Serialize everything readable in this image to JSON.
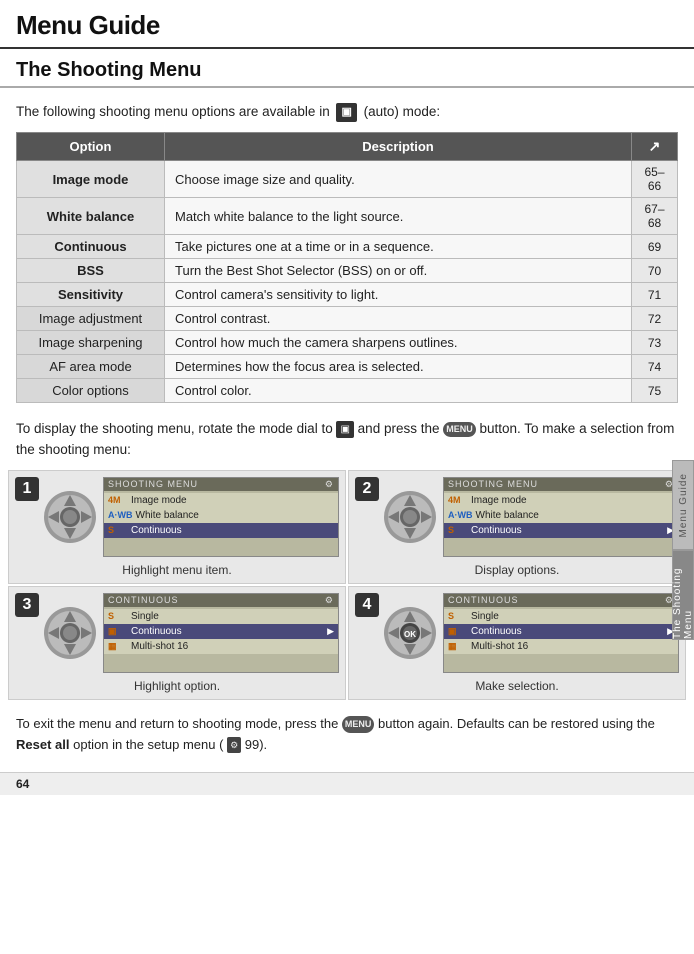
{
  "header": {
    "title": "Menu Guide"
  },
  "section": {
    "title": "The Shooting Menu"
  },
  "intro": {
    "text": "The following shooting menu options are available in",
    "mode": "(auto) mode:"
  },
  "table": {
    "col_option": "Option",
    "col_desc": "Description",
    "col_page_icon": "↗",
    "rows": [
      {
        "option": "Image mode",
        "desc": "Choose image size and quality.",
        "page": "65–66",
        "bold": true
      },
      {
        "option": "White balance",
        "desc": "Match white balance to the light source.",
        "page": "67–68",
        "bold": true
      },
      {
        "option": "Continuous",
        "desc": "Take pictures one at a time or in a sequence.",
        "page": "69",
        "bold": true
      },
      {
        "option": "BSS",
        "desc": "Turn the Best Shot Selector (BSS) on or off.",
        "page": "70",
        "bold": true
      },
      {
        "option": "Sensitivity",
        "desc": "Control camera's sensitivity to light.",
        "page": "71",
        "bold": true
      },
      {
        "option": "Image adjustment",
        "desc": "Control contrast.",
        "page": "72",
        "bold": false
      },
      {
        "option": "Image sharpening",
        "desc": "Control how much the camera sharpens outlines.",
        "page": "73",
        "bold": false
      },
      {
        "option": "AF area mode",
        "desc": "Determines how the focus area is selected.",
        "page": "74",
        "bold": false
      },
      {
        "option": "Color options",
        "desc": "Control color.",
        "page": "75",
        "bold": false
      }
    ]
  },
  "desc_para": {
    "text1": "To display the shooting menu, rotate the mode dial to",
    "text2": "and press the",
    "text3": "button.  To make a selection from the shooting menu:"
  },
  "steps": [
    {
      "number": "1",
      "caption": "Highlight menu item.",
      "screen_title": "SHOOTING MENU",
      "rows": [
        {
          "icon": "4M",
          "icon_color": "orange",
          "label": "Image mode",
          "highlighted": false,
          "arrow": false
        },
        {
          "icon": "A·WB",
          "icon_color": "blue",
          "label": "White balance",
          "highlighted": false,
          "arrow": false
        },
        {
          "icon": "S",
          "icon_color": "orange",
          "label": "Continuous",
          "highlighted": true,
          "arrow": false
        }
      ]
    },
    {
      "number": "2",
      "caption": "Display options.",
      "screen_title": "SHOOTING MENU",
      "rows": [
        {
          "icon": "4M",
          "icon_color": "orange",
          "label": "Image mode",
          "highlighted": false,
          "arrow": false
        },
        {
          "icon": "A·WB",
          "icon_color": "blue",
          "label": "White balance",
          "highlighted": false,
          "arrow": false
        },
        {
          "icon": "S",
          "icon_color": "orange",
          "label": "Continuous",
          "highlighted": true,
          "arrow": true
        }
      ]
    },
    {
      "number": "3",
      "caption": "Highlight option.",
      "screen_title": "CONTINUOUS",
      "rows": [
        {
          "icon": "S",
          "icon_color": "orange",
          "label": "Single",
          "highlighted": false,
          "arrow": false
        },
        {
          "icon": "▣",
          "icon_color": "orange",
          "label": "Continuous",
          "highlighted": true,
          "arrow": true
        },
        {
          "icon": "▦",
          "icon_color": "orange",
          "label": "Multi-shot 16",
          "highlighted": false,
          "arrow": false
        }
      ]
    },
    {
      "number": "4",
      "caption": "Make selection.",
      "screen_title": "CONTINUOUS",
      "rows": [
        {
          "icon": "S",
          "icon_color": "orange",
          "label": "Single",
          "highlighted": false,
          "arrow": false
        },
        {
          "icon": "▣",
          "icon_color": "orange",
          "label": "Continuous",
          "highlighted": true,
          "arrow": true
        },
        {
          "icon": "▦",
          "icon_color": "orange",
          "label": "Multi-shot 16",
          "highlighted": false,
          "arrow": false
        }
      ]
    }
  ],
  "bottom_text": {
    "text1": "To exit the menu and return to shooting mode, press the",
    "btn1": "MENU",
    "text2": "button again.  De­faults can be restored using the",
    "bold_word": "Reset all",
    "text3": "option in the setup menu (",
    "icon": "SETUP",
    "text4": "99)."
  },
  "sidebar_tabs": [
    {
      "label": "Menu Guide",
      "active": false
    },
    {
      "label": "The Shooting Menu",
      "active": true
    }
  ],
  "page_number": "64"
}
